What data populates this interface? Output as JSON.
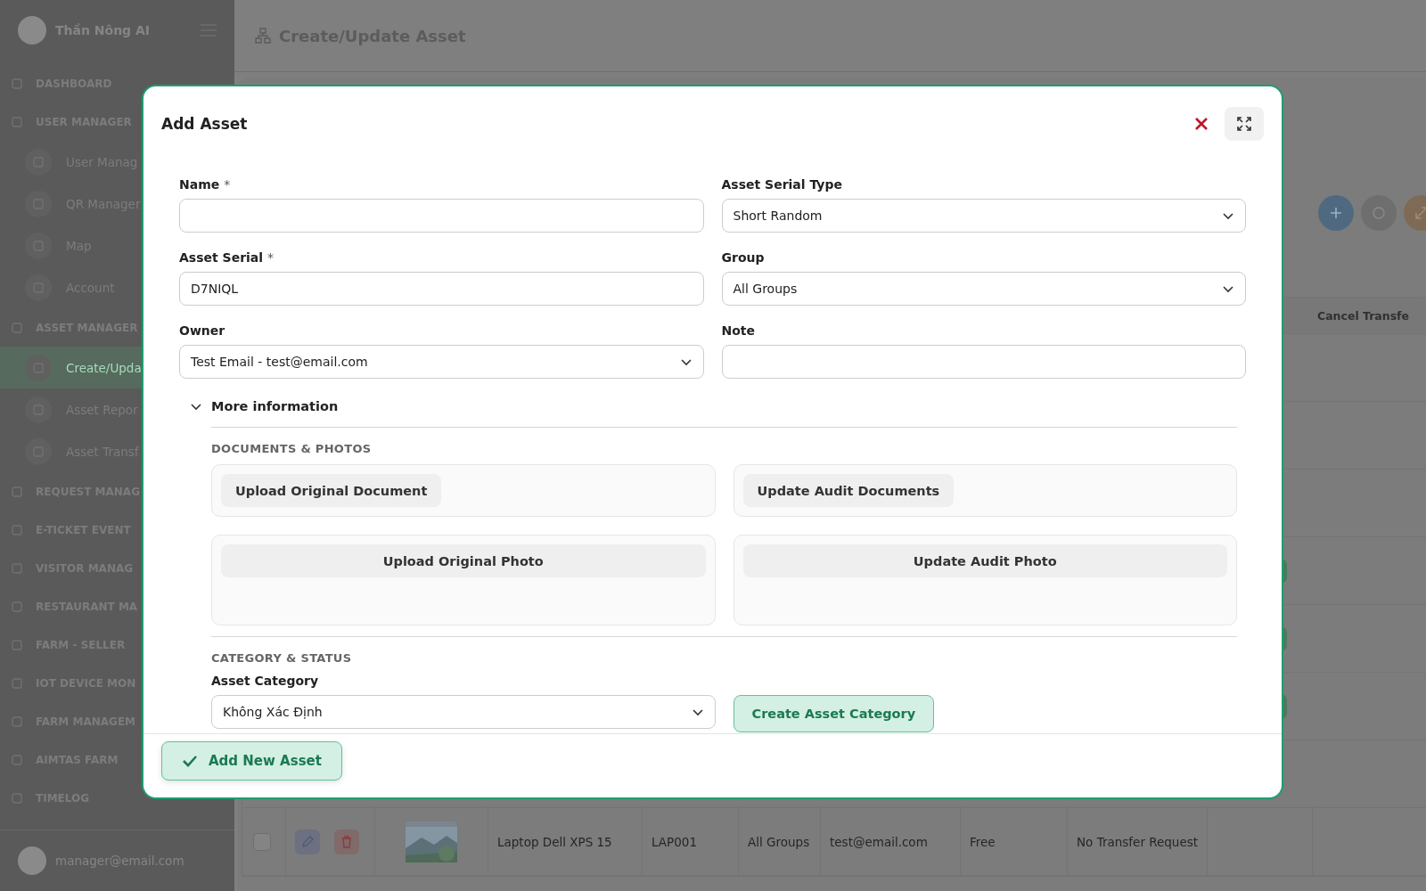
{
  "sidebar": {
    "brand": "Thần Nông AI",
    "items": [
      {
        "label": "DASHBOARD",
        "selected": false
      },
      {
        "label": "USER MANAGER",
        "selected": false,
        "children": [
          {
            "label": "User Manag",
            "selected": false
          },
          {
            "label": "QR Manager",
            "selected": false
          },
          {
            "label": "Map",
            "selected": false
          },
          {
            "label": "Account",
            "selected": false
          }
        ]
      },
      {
        "label": "ASSET MANAGER",
        "selected": false,
        "children": [
          {
            "label": "Create/Upda",
            "selected": true
          },
          {
            "label": "Asset Repor",
            "selected": false
          },
          {
            "label": "Asset Transf",
            "selected": false
          }
        ]
      },
      {
        "label": "REQUEST MANAG",
        "selected": false
      },
      {
        "label": "E-TICKET EVENT",
        "selected": false
      },
      {
        "label": "VISITOR MANAG",
        "selected": false
      },
      {
        "label": "RESTAURANT MA",
        "selected": false
      },
      {
        "label": "FARM - SELLER",
        "selected": false
      },
      {
        "label": "IOT DEVICE MON",
        "selected": false
      },
      {
        "label": "FARM MANAGEM",
        "selected": false
      },
      {
        "label": "AIMTAS FARM",
        "selected": false
      },
      {
        "label": "TIMELOG",
        "selected": false
      }
    ],
    "user": "manager@email.com"
  },
  "header": {
    "title": "Create/Update Asset"
  },
  "table": {
    "last_column": "Cancel Transfe",
    "rows": [
      {
        "checked": false,
        "cells": [
          "Laptop Dell XPS 15",
          "LAP001",
          "All Groups",
          "test@email.com",
          "Free",
          "No Transfer Request"
        ]
      }
    ]
  },
  "modal": {
    "title": "Add Asset",
    "fields": [
      {
        "label": "Name",
        "required_mark": "*",
        "kind": "input"
      },
      {
        "label": "Asset Serial Type",
        "kind": "select",
        "value": "Short Random"
      },
      {
        "label": "Asset Serial",
        "required_mark": "*",
        "kind": "input",
        "value": "D7NIQL"
      },
      {
        "label": "Group",
        "kind": "select",
        "value": "All Groups"
      },
      {
        "label": "Owner",
        "kind": "select",
        "value": "Test Email - test@email.com"
      },
      {
        "label": "Note",
        "kind": "input"
      }
    ],
    "more_info": {
      "label": "More information",
      "expanded": true
    },
    "documents": {
      "heading": "DOCUMENTS & PHOTOS",
      "documents": [
        "Upload Original Document",
        "Update Audit Documents"
      ],
      "photos": [
        "Upload Original Photo",
        "Update Audit Photo"
      ]
    },
    "category": {
      "heading": "CATEGORY & STATUS",
      "label": "Asset Category",
      "value": "Không Xác Định",
      "create_button": "Create Asset Category"
    },
    "submit": "Add New Asset"
  }
}
